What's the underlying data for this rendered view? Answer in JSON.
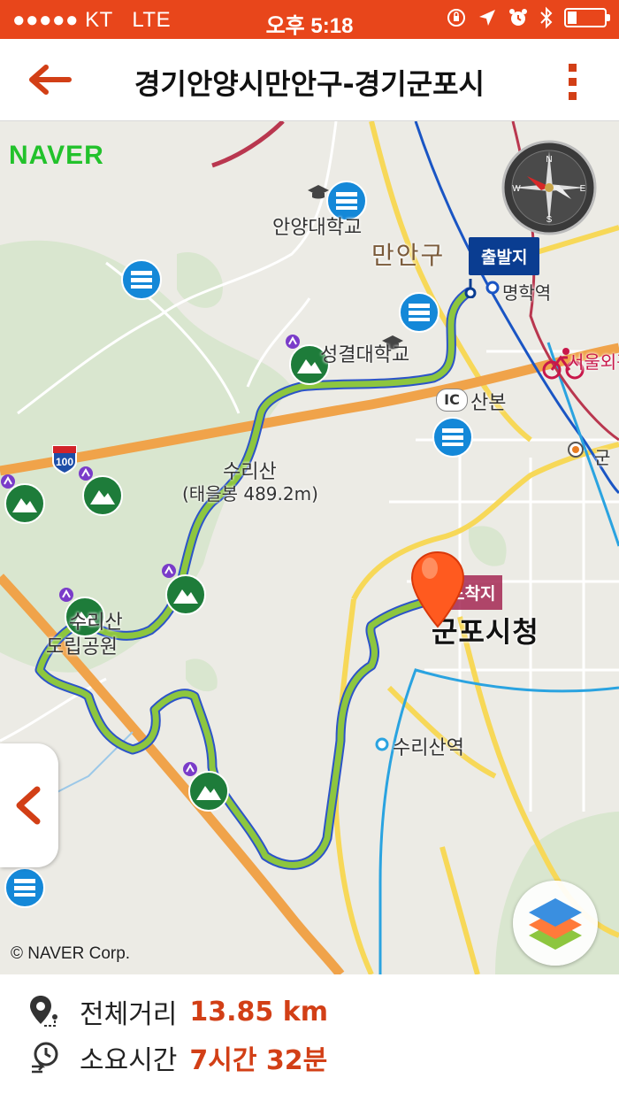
{
  "status_bar": {
    "carrier": "●●●●● KT",
    "network": "LTE",
    "time": "오후 5:18"
  },
  "header": {
    "title": "경기안양시만안구-경기군포시"
  },
  "map": {
    "provider_logo": "NAVER",
    "copyright": "© NAVER Corp.",
    "start_label": "출발지",
    "end_label": "도착지",
    "place_labels": {
      "anyang_univ": "안양대학교",
      "manangu": "만안구",
      "myeonghak": "명학역",
      "sungkyul": "성결대학교",
      "ic": "IC",
      "sanbon": "산본",
      "surisan": "수리산",
      "surisan_height": "(태을봉 489.2m)",
      "gunpo_cityhall": "군포시청",
      "surisan_station": "수리산역",
      "seoul_outer": "서울외곽",
      "gun": "군",
      "highway_no": "100",
      "dorip_park_1": "수리산",
      "dorip_park_2": "도립공원"
    }
  },
  "footer": {
    "distance_label": "전체거리",
    "distance_value": "13.85 km",
    "time_label": "소요시간",
    "time_value": "7시간 32분"
  },
  "colors": {
    "accent": "#e8461b",
    "value": "#d23f16",
    "route": "#8dc63f",
    "start_flag": "#0a3d91",
    "naver": "#22c22b"
  },
  "icons": [
    "back-arrow-icon",
    "more-vert-icon",
    "compass-icon",
    "layers-icon",
    "chevron-left-icon",
    "route-pin-icon",
    "clock-icon",
    "mountain-icon",
    "bus-icon",
    "school-icon",
    "subway-icon",
    "location-pin-icon",
    "battery-icon"
  ]
}
